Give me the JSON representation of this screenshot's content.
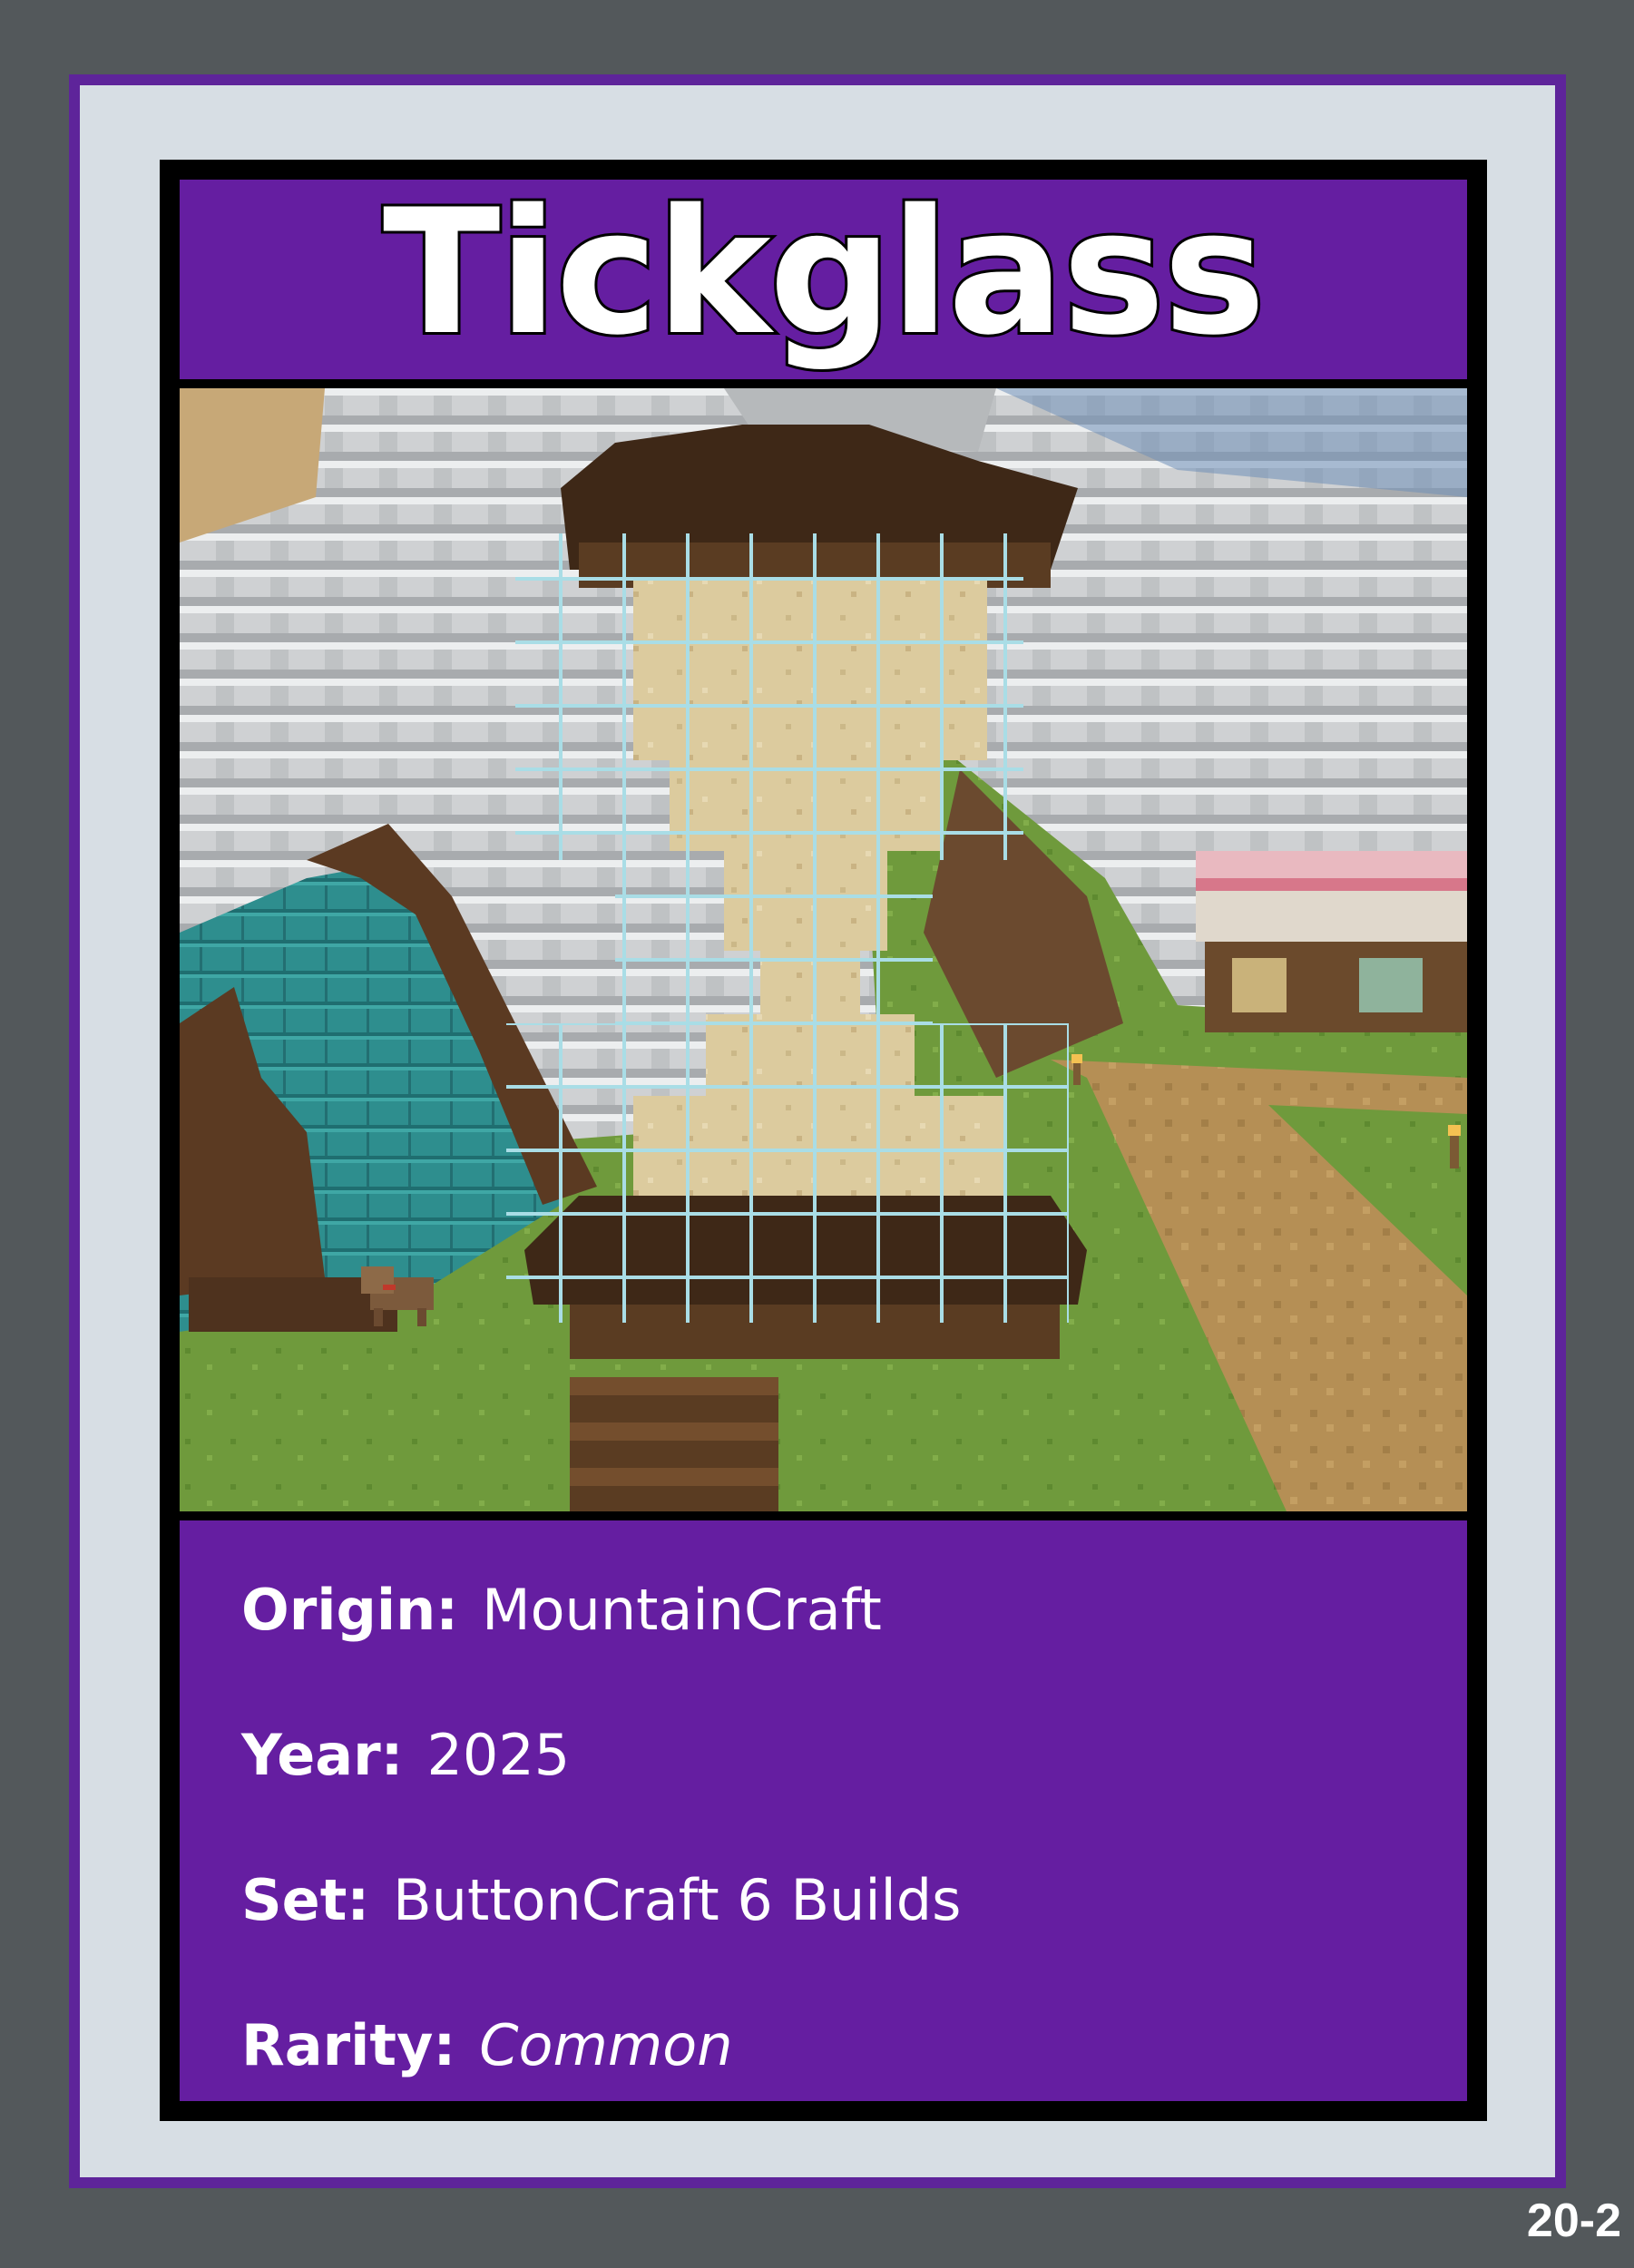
{
  "card": {
    "title": "Tickglass",
    "number": "20-2",
    "colors": {
      "background": "#53585b",
      "frame": "#5e249a",
      "panel": "#651ea1",
      "mat": "#d7dee4"
    },
    "image": {
      "subject": "minecraft-hourglass-build",
      "icon": "screenshot-image"
    },
    "fields": [
      {
        "label": "Origin:",
        "value": "MountainCraft"
      },
      {
        "label": "Year:",
        "value": "2025"
      },
      {
        "label": "Set:",
        "value": "ButtonCraft 6 Builds"
      },
      {
        "label": "Rarity:",
        "value": "Common"
      }
    ]
  }
}
